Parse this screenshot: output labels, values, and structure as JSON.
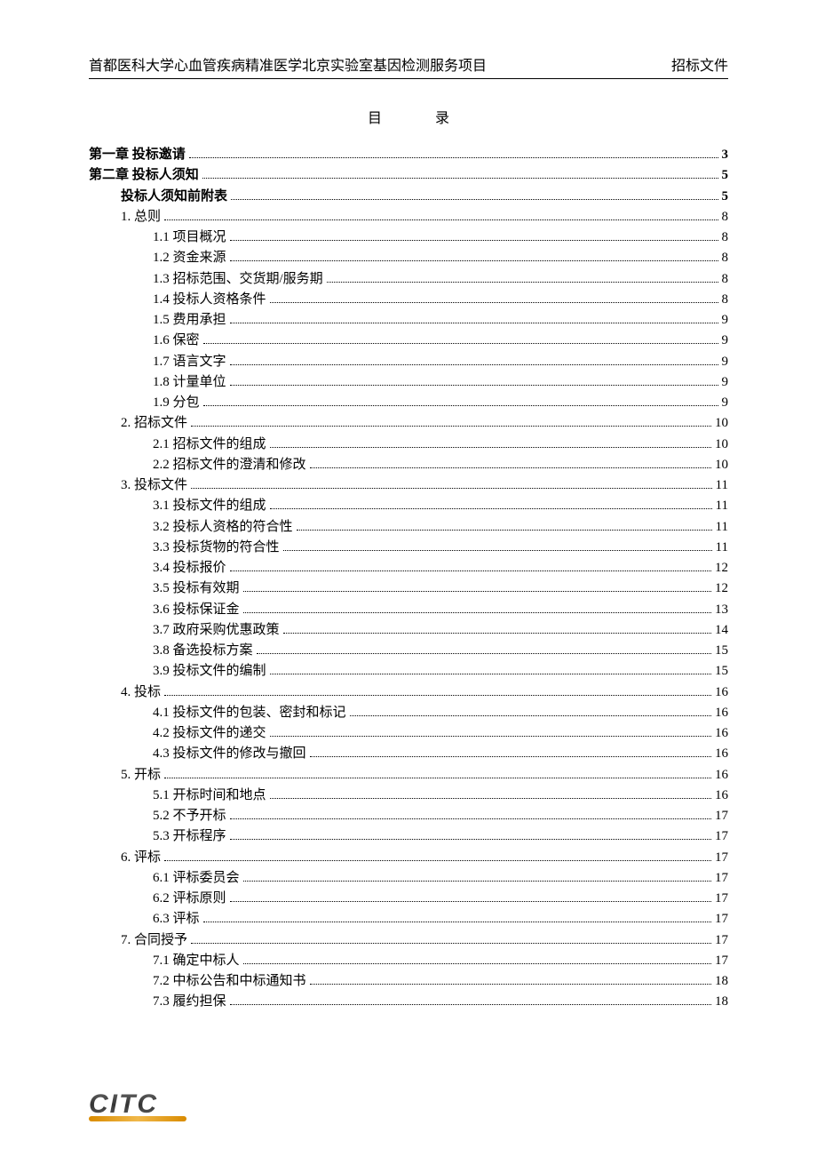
{
  "header": {
    "left": "首都医科大学心血管疾病精准医学北京实验室基因检测服务项目",
    "right": "招标文件"
  },
  "toc_title": "目录",
  "logo_text": "CITC",
  "toc": [
    {
      "label": "第一章 投标邀请",
      "page": "3",
      "indent": 0,
      "bold": true
    },
    {
      "label": "第二章 投标人须知",
      "page": "5",
      "indent": 0,
      "bold": true
    },
    {
      "label": "投标人须知前附表",
      "page": "5",
      "indent": 1,
      "bold": true
    },
    {
      "label": "1. 总则",
      "page": "8",
      "indent": 2,
      "bold": false
    },
    {
      "label": "1.1 项目概况",
      "page": "8",
      "indent": 3,
      "bold": false
    },
    {
      "label": "1.2 资金来源",
      "page": "8",
      "indent": 3,
      "bold": false
    },
    {
      "label": "1.3 招标范围、交货期/服务期",
      "page": "8",
      "indent": 3,
      "bold": false
    },
    {
      "label": "1.4 投标人资格条件",
      "page": "8",
      "indent": 3,
      "bold": false
    },
    {
      "label": "1.5 费用承担",
      "page": "9",
      "indent": 3,
      "bold": false
    },
    {
      "label": "1.6 保密",
      "page": "9",
      "indent": 3,
      "bold": false
    },
    {
      "label": "1.7 语言文字",
      "page": "9",
      "indent": 3,
      "bold": false
    },
    {
      "label": "1.8 计量单位",
      "page": "9",
      "indent": 3,
      "bold": false
    },
    {
      "label": "1.9 分包",
      "page": "9",
      "indent": 3,
      "bold": false
    },
    {
      "label": "2. 招标文件",
      "page": "10",
      "indent": 2,
      "bold": false
    },
    {
      "label": "2.1 招标文件的组成",
      "page": "10",
      "indent": 3,
      "bold": false
    },
    {
      "label": "2.2 招标文件的澄清和修改",
      "page": "10",
      "indent": 3,
      "bold": false
    },
    {
      "label": "3. 投标文件",
      "page": "11",
      "indent": 2,
      "bold": false
    },
    {
      "label": "3.1 投标文件的组成",
      "page": "11",
      "indent": 3,
      "bold": false
    },
    {
      "label": "3.2 投标人资格的符合性",
      "page": "11",
      "indent": 3,
      "bold": false
    },
    {
      "label": "3.3 投标货物的符合性",
      "page": "11",
      "indent": 3,
      "bold": false
    },
    {
      "label": "3.4 投标报价",
      "page": "12",
      "indent": 3,
      "bold": false
    },
    {
      "label": "3.5 投标有效期",
      "page": "12",
      "indent": 3,
      "bold": false
    },
    {
      "label": "3.6 投标保证金",
      "page": "13",
      "indent": 3,
      "bold": false
    },
    {
      "label": "3.7 政府采购优惠政策",
      "page": "14",
      "indent": 3,
      "bold": false
    },
    {
      "label": "3.8 备选投标方案",
      "page": "15",
      "indent": 3,
      "bold": false
    },
    {
      "label": "3.9 投标文件的编制",
      "page": "15",
      "indent": 3,
      "bold": false
    },
    {
      "label": "4. 投标",
      "page": "16",
      "indent": 2,
      "bold": false
    },
    {
      "label": "4.1 投标文件的包装、密封和标记",
      "page": "16",
      "indent": 3,
      "bold": false
    },
    {
      "label": "4.2 投标文件的递交",
      "page": "16",
      "indent": 3,
      "bold": false
    },
    {
      "label": "4.3 投标文件的修改与撤回",
      "page": "16",
      "indent": 3,
      "bold": false
    },
    {
      "label": "5. 开标",
      "page": "16",
      "indent": 2,
      "bold": false
    },
    {
      "label": "5.1 开标时间和地点",
      "page": "16",
      "indent": 3,
      "bold": false
    },
    {
      "label": "5.2 不予开标",
      "page": "17",
      "indent": 3,
      "bold": false
    },
    {
      "label": "5.3 开标程序",
      "page": "17",
      "indent": 3,
      "bold": false
    },
    {
      "label": "6. 评标",
      "page": "17",
      "indent": 2,
      "bold": false
    },
    {
      "label": "6.1 评标委员会",
      "page": "17",
      "indent": 3,
      "bold": false
    },
    {
      "label": "6.2 评标原则",
      "page": "17",
      "indent": 3,
      "bold": false
    },
    {
      "label": "6.3 评标",
      "page": "17",
      "indent": 3,
      "bold": false
    },
    {
      "label": "7. 合同授予",
      "page": "17",
      "indent": 2,
      "bold": false
    },
    {
      "label": "7.1 确定中标人",
      "page": "17",
      "indent": 3,
      "bold": false
    },
    {
      "label": "7.2 中标公告和中标通知书",
      "page": "18",
      "indent": 3,
      "bold": false
    },
    {
      "label": "7.3 履约担保",
      "page": "18",
      "indent": 3,
      "bold": false
    }
  ]
}
